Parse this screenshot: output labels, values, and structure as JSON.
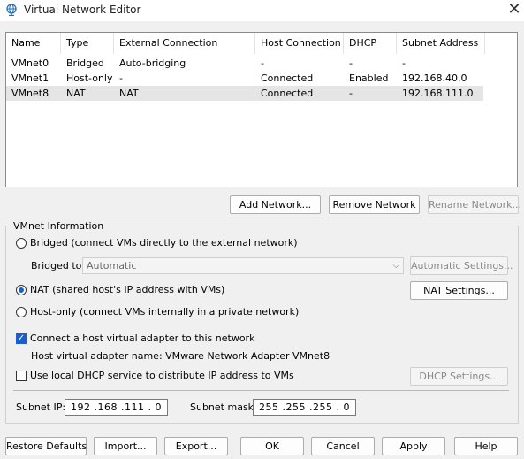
{
  "window": {
    "title": "Virtual Network Editor",
    "close_icon": "close-icon",
    "app_icon": "globe-icon"
  },
  "table": {
    "headers": [
      "Name",
      "Type",
      "External Connection",
      "Host Connection",
      "DHCP",
      "Subnet Address"
    ],
    "rows": [
      [
        "VMnet0",
        "Bridged",
        "Auto-bridging",
        "-",
        "-",
        "-"
      ],
      [
        "VMnet1",
        "Host-only",
        "-",
        "Connected",
        "Enabled",
        "192.168.40.0"
      ],
      [
        "VMnet8",
        "NAT",
        "NAT",
        "Connected",
        "-",
        "192.168.111.0"
      ]
    ],
    "selected_row": 2
  },
  "network_buttons": {
    "add": "Add Network...",
    "remove": "Remove Network",
    "rename": "Rename Network..."
  },
  "info": {
    "group_label": "VMnet Information",
    "bridged_label": "Bridged (connect VMs directly to the external network)",
    "bridged_to_label": "Bridged to:",
    "bridged_to_value": "Automatic",
    "auto_settings": "Automatic Settings...",
    "nat_label": "NAT (shared host's IP address with VMs)",
    "nat_settings": "NAT Settings...",
    "hostonly_label": "Host-only (connect VMs internally in a private network)",
    "connect_adapter_label": "Connect a host virtual adapter to this network",
    "adapter_name_text": "Host virtual adapter name: VMware Network Adapter VMnet8",
    "dhcp_label": "Use local DHCP service to distribute IP address to VMs",
    "dhcp_settings": "DHCP Settings...",
    "subnet_ip_label": "Subnet IP:",
    "subnet_ip": "192 .168 .111 . 0",
    "subnet_mask_label": "Subnet mask:",
    "subnet_mask": "255 .255 .255 . 0",
    "selected_mode": "nat",
    "connect_adapter_checked": true,
    "dhcp_checked": false
  },
  "footer": {
    "restore": "Restore Defaults",
    "import": "Import...",
    "export": "Export...",
    "ok": "OK",
    "cancel": "Cancel",
    "apply": "Apply",
    "help": "Help"
  },
  "colors": {
    "accent": "#1a60c8",
    "selected_row": "#e5e5e5"
  }
}
